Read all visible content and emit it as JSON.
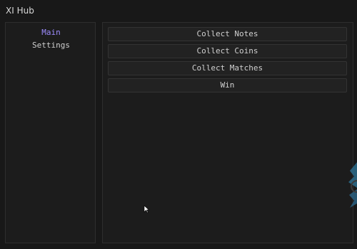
{
  "window": {
    "title": "XI Hub"
  },
  "colors": {
    "accent": "#9d8cff",
    "background": "#181818",
    "panel": "#1c1c1c",
    "button": "#222222",
    "border": "#2e2e2e",
    "text": "#d0d0d0"
  },
  "sidebar": {
    "items": [
      {
        "label": "Main",
        "active": true
      },
      {
        "label": "Settings",
        "active": false
      }
    ]
  },
  "main": {
    "buttons": [
      {
        "label": "Collect Notes"
      },
      {
        "label": "Collect Coins"
      },
      {
        "label": "Collect Matches"
      },
      {
        "label": "Win"
      }
    ]
  },
  "icons": {
    "cursor": "mouse-pointer-icon",
    "edge_decoration": "blue-ornament-icon"
  }
}
